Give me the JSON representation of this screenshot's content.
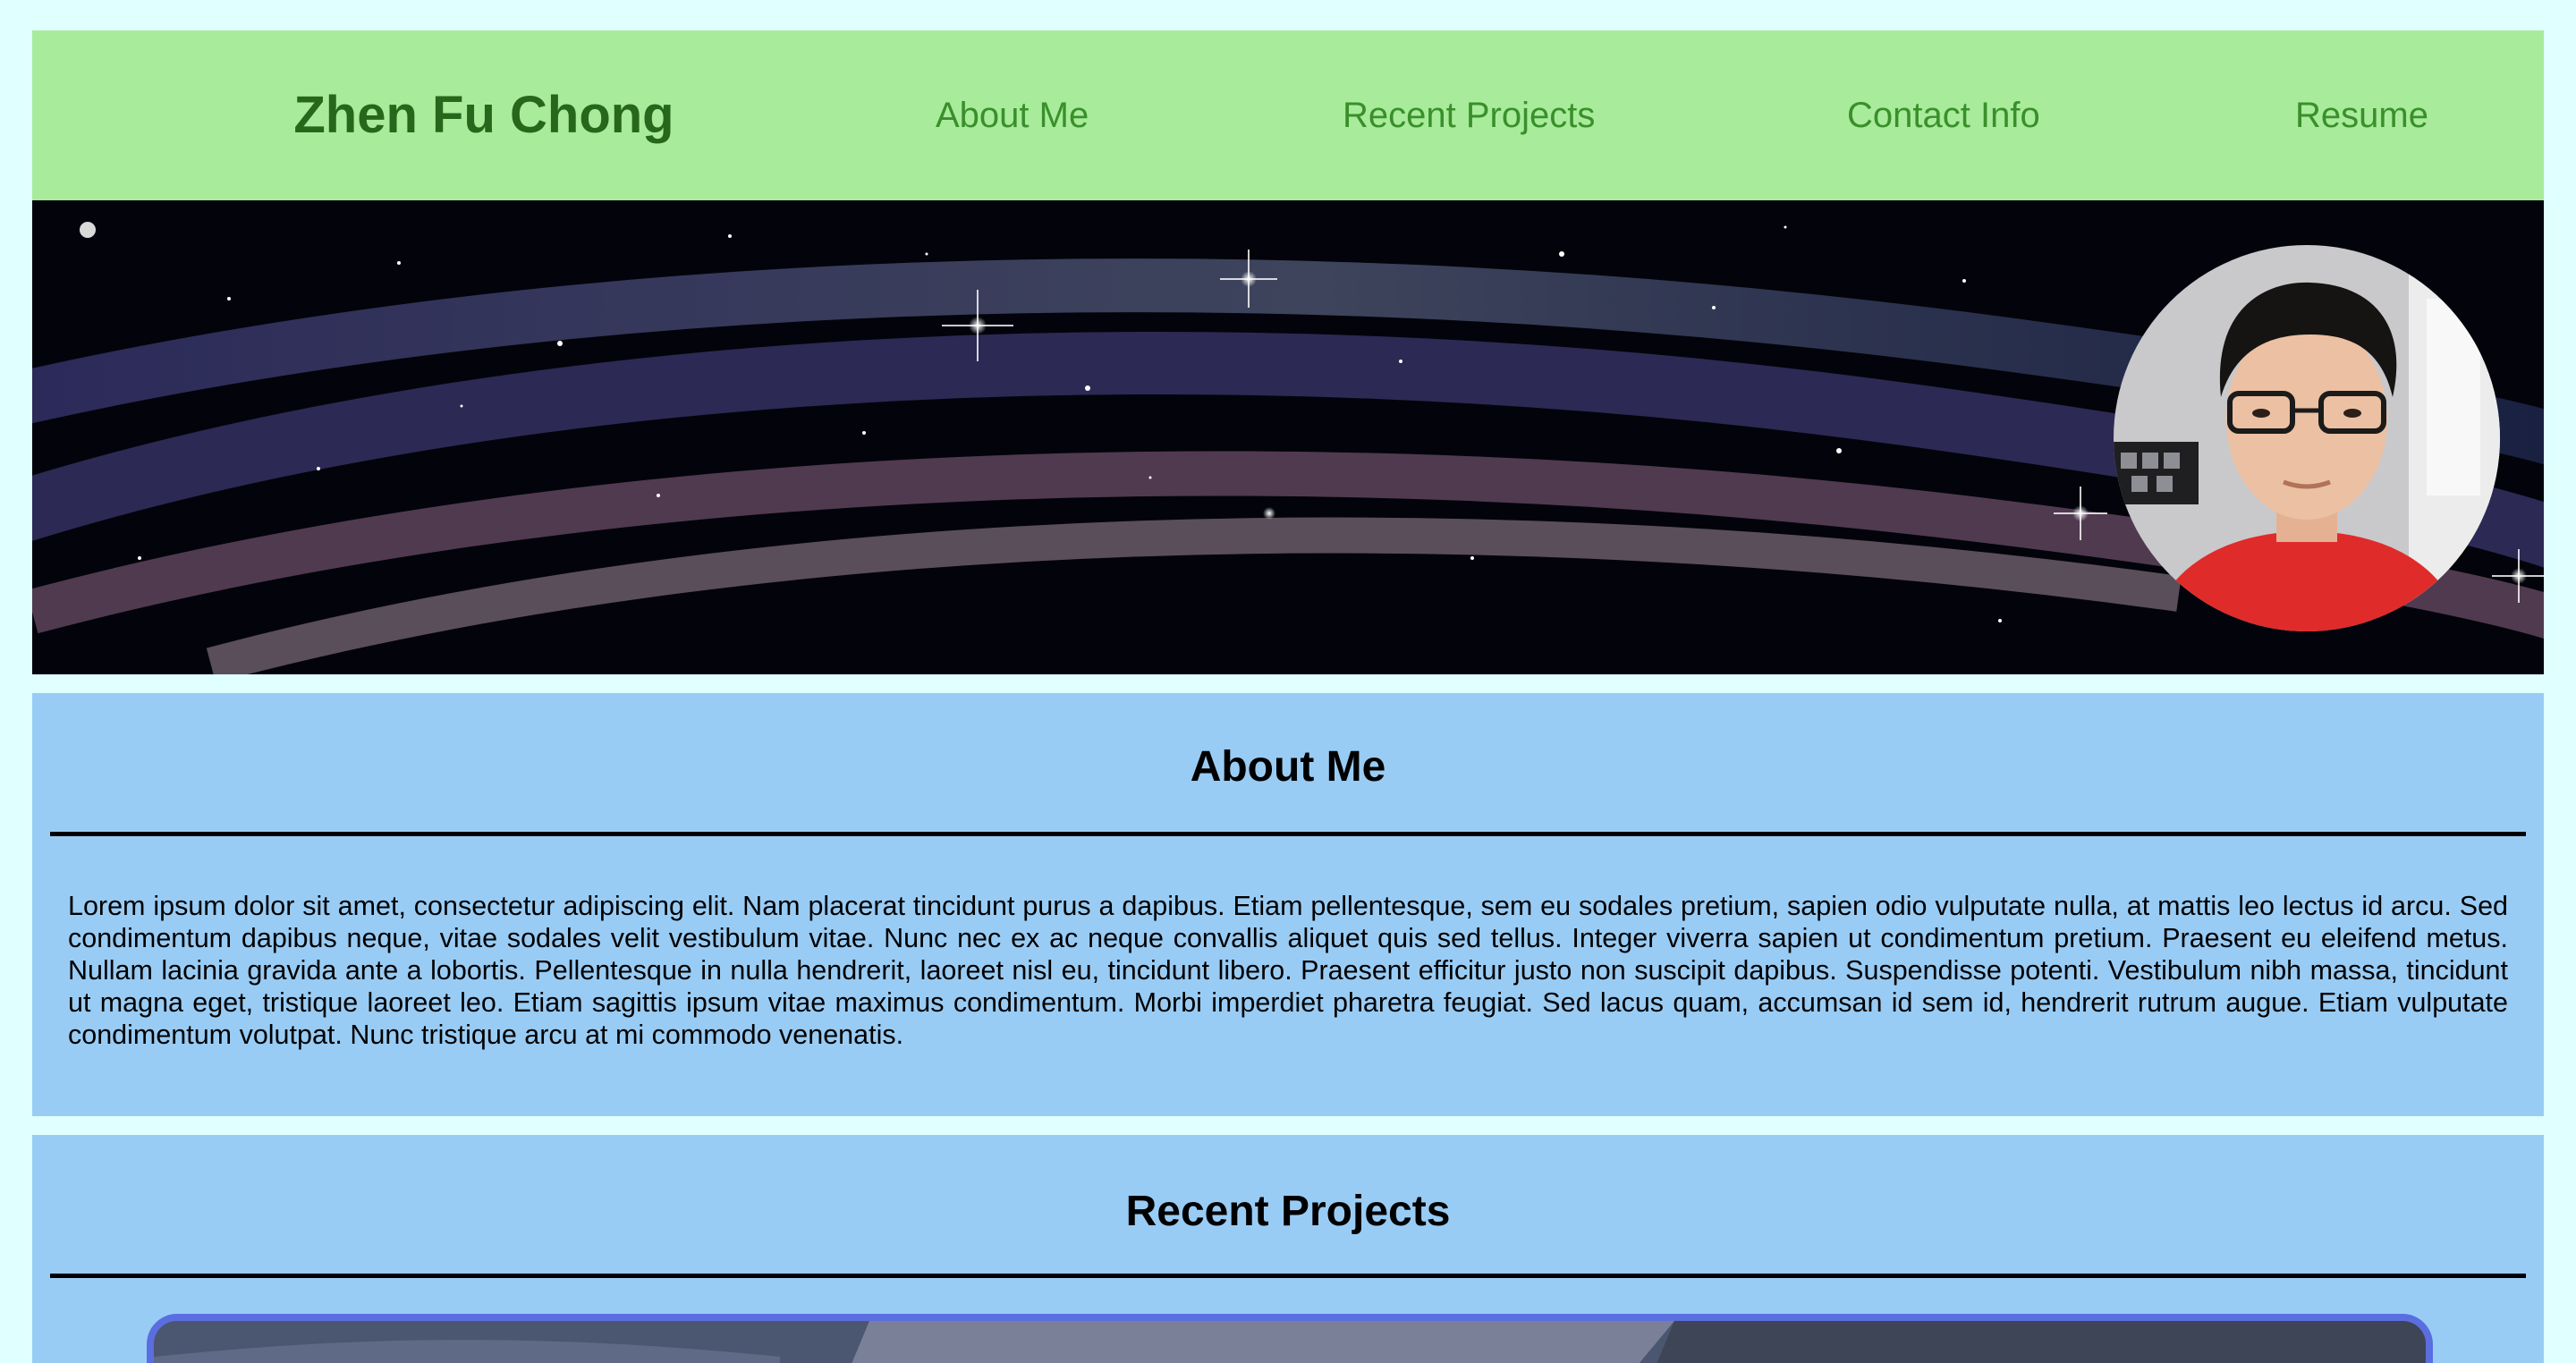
{
  "header": {
    "site_title": "Zhen Fu Chong",
    "nav": [
      {
        "label": "About Me"
      },
      {
        "label": "Recent Projects"
      },
      {
        "label": "Contact Info"
      },
      {
        "label": "Resume"
      }
    ]
  },
  "about": {
    "heading": "About Me",
    "body": "Lorem ipsum dolor sit amet, consectetur adipiscing elit. Nam placerat tincidunt purus a dapibus. Etiam pellentesque, sem eu sodales pretium, sapien odio vulputate nulla, at mattis leo lectus id arcu. Sed condimentum dapibus neque, vitae sodales velit vestibulum vitae. Nunc nec ex ac neque convallis aliquet quis sed tellus. Integer viverra sapien ut condimentum pretium. Praesent eu eleifend metus. Nullam lacinia gravida ante a lobortis. Pellentesque in nulla hendrerit, laoreet nisl eu, tincidunt libero. Praesent efficitur justo non suscipit dapibus. Suspendisse potenti. Vestibulum nibh massa, tincidunt ut magna eget, tristique laoreet leo. Etiam sagittis ipsum vitae maximus condimentum. Morbi imperdiet pharetra feugiat. Sed lacus quam, accumsan id sem id, hendrerit rutrum augue. Etiam vulputate condimentum volutpat. Nunc tristique arcu at mi commodo venenatis."
  },
  "projects": {
    "heading": "Recent Projects"
  },
  "colors": {
    "page_background": "#e0ffff",
    "header_background": "#a8ec9b",
    "title_color": "#27671b",
    "nav_color": "#3a8f2b",
    "section_background": "#99ccf5",
    "card_border": "#5a6ee0"
  }
}
